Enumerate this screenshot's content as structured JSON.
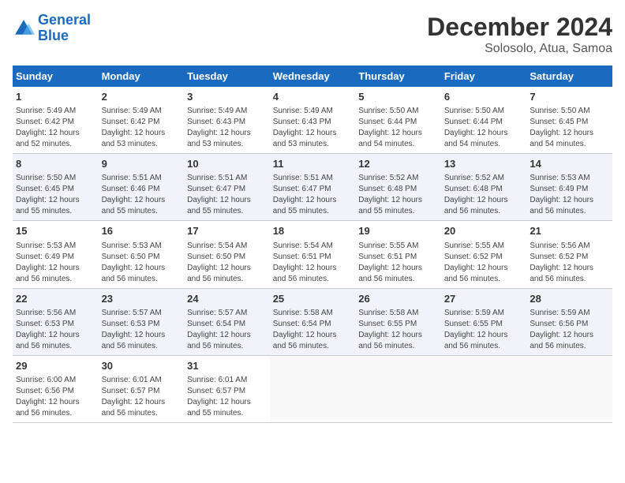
{
  "header": {
    "logo_line1": "General",
    "logo_line2": "Blue",
    "month": "December 2024",
    "location": "Solosolo, Atua, Samoa"
  },
  "weekdays": [
    "Sunday",
    "Monday",
    "Tuesday",
    "Wednesday",
    "Thursday",
    "Friday",
    "Saturday"
  ],
  "weeks": [
    [
      {
        "day": "1",
        "info": "Sunrise: 5:49 AM\nSunset: 6:42 PM\nDaylight: 12 hours\nand 52 minutes."
      },
      {
        "day": "2",
        "info": "Sunrise: 5:49 AM\nSunset: 6:42 PM\nDaylight: 12 hours\nand 53 minutes."
      },
      {
        "day": "3",
        "info": "Sunrise: 5:49 AM\nSunset: 6:43 PM\nDaylight: 12 hours\nand 53 minutes."
      },
      {
        "day": "4",
        "info": "Sunrise: 5:49 AM\nSunset: 6:43 PM\nDaylight: 12 hours\nand 53 minutes."
      },
      {
        "day": "5",
        "info": "Sunrise: 5:50 AM\nSunset: 6:44 PM\nDaylight: 12 hours\nand 54 minutes."
      },
      {
        "day": "6",
        "info": "Sunrise: 5:50 AM\nSunset: 6:44 PM\nDaylight: 12 hours\nand 54 minutes."
      },
      {
        "day": "7",
        "info": "Sunrise: 5:50 AM\nSunset: 6:45 PM\nDaylight: 12 hours\nand 54 minutes."
      }
    ],
    [
      {
        "day": "8",
        "info": "Sunrise: 5:50 AM\nSunset: 6:45 PM\nDaylight: 12 hours\nand 55 minutes."
      },
      {
        "day": "9",
        "info": "Sunrise: 5:51 AM\nSunset: 6:46 PM\nDaylight: 12 hours\nand 55 minutes."
      },
      {
        "day": "10",
        "info": "Sunrise: 5:51 AM\nSunset: 6:47 PM\nDaylight: 12 hours\nand 55 minutes."
      },
      {
        "day": "11",
        "info": "Sunrise: 5:51 AM\nSunset: 6:47 PM\nDaylight: 12 hours\nand 55 minutes."
      },
      {
        "day": "12",
        "info": "Sunrise: 5:52 AM\nSunset: 6:48 PM\nDaylight: 12 hours\nand 55 minutes."
      },
      {
        "day": "13",
        "info": "Sunrise: 5:52 AM\nSunset: 6:48 PM\nDaylight: 12 hours\nand 56 minutes."
      },
      {
        "day": "14",
        "info": "Sunrise: 5:53 AM\nSunset: 6:49 PM\nDaylight: 12 hours\nand 56 minutes."
      }
    ],
    [
      {
        "day": "15",
        "info": "Sunrise: 5:53 AM\nSunset: 6:49 PM\nDaylight: 12 hours\nand 56 minutes."
      },
      {
        "day": "16",
        "info": "Sunrise: 5:53 AM\nSunset: 6:50 PM\nDaylight: 12 hours\nand 56 minutes."
      },
      {
        "day": "17",
        "info": "Sunrise: 5:54 AM\nSunset: 6:50 PM\nDaylight: 12 hours\nand 56 minutes."
      },
      {
        "day": "18",
        "info": "Sunrise: 5:54 AM\nSunset: 6:51 PM\nDaylight: 12 hours\nand 56 minutes."
      },
      {
        "day": "19",
        "info": "Sunrise: 5:55 AM\nSunset: 6:51 PM\nDaylight: 12 hours\nand 56 minutes."
      },
      {
        "day": "20",
        "info": "Sunrise: 5:55 AM\nSunset: 6:52 PM\nDaylight: 12 hours\nand 56 minutes."
      },
      {
        "day": "21",
        "info": "Sunrise: 5:56 AM\nSunset: 6:52 PM\nDaylight: 12 hours\nand 56 minutes."
      }
    ],
    [
      {
        "day": "22",
        "info": "Sunrise: 5:56 AM\nSunset: 6:53 PM\nDaylight: 12 hours\nand 56 minutes."
      },
      {
        "day": "23",
        "info": "Sunrise: 5:57 AM\nSunset: 6:53 PM\nDaylight: 12 hours\nand 56 minutes."
      },
      {
        "day": "24",
        "info": "Sunrise: 5:57 AM\nSunset: 6:54 PM\nDaylight: 12 hours\nand 56 minutes."
      },
      {
        "day": "25",
        "info": "Sunrise: 5:58 AM\nSunset: 6:54 PM\nDaylight: 12 hours\nand 56 minutes."
      },
      {
        "day": "26",
        "info": "Sunrise: 5:58 AM\nSunset: 6:55 PM\nDaylight: 12 hours\nand 56 minutes."
      },
      {
        "day": "27",
        "info": "Sunrise: 5:59 AM\nSunset: 6:55 PM\nDaylight: 12 hours\nand 56 minutes."
      },
      {
        "day": "28",
        "info": "Sunrise: 5:59 AM\nSunset: 6:56 PM\nDaylight: 12 hours\nand 56 minutes."
      }
    ],
    [
      {
        "day": "29",
        "info": "Sunrise: 6:00 AM\nSunset: 6:56 PM\nDaylight: 12 hours\nand 56 minutes."
      },
      {
        "day": "30",
        "info": "Sunrise: 6:01 AM\nSunset: 6:57 PM\nDaylight: 12 hours\nand 56 minutes."
      },
      {
        "day": "31",
        "info": "Sunrise: 6:01 AM\nSunset: 6:57 PM\nDaylight: 12 hours\nand 55 minutes."
      },
      null,
      null,
      null,
      null
    ]
  ]
}
